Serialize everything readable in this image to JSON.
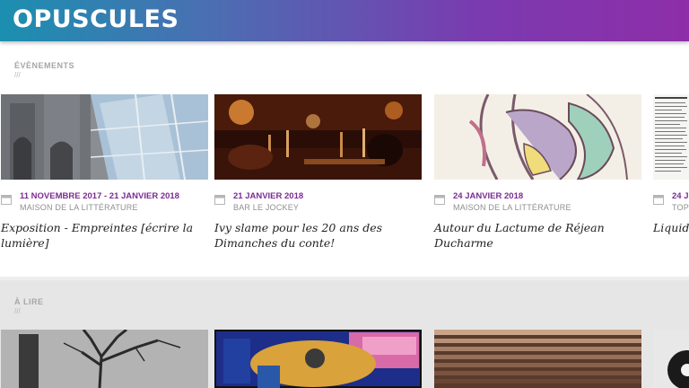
{
  "header": {
    "logo_text": "OPUSCULES",
    "logo_icon": "wifi-wave-icon"
  },
  "events": {
    "title": "ÉVÈNEMENTS",
    "slashes": "///",
    "cards": [
      {
        "date": "11 NOVEMBRE 2017 - 21 JANVIER 2018",
        "venue": "MAISON DE LA LITTÉRATURE",
        "title": "Exposition - Empreintes [écrire la lumière]",
        "image_icon": "church-facade-photo"
      },
      {
        "date": "21 JANVIER 2018",
        "venue": "BAR LE JOCKEY",
        "title": "Ivy slame pour les 20 ans des Dimanches du conte!",
        "image_icon": "bar-photo"
      },
      {
        "date": "24 JANVIER 2018",
        "venue": "MAISON DE LA LITTÉRATURE",
        "title": "Autour du Lactume de Réjean Ducharme",
        "image_icon": "stained-drawing-image"
      },
      {
        "date": "24 J",
        "venue": "TOPO",
        "title": "Liquida",
        "image_icon": "newspaper-clipping-image"
      }
    ]
  },
  "read": {
    "title": "À LIRE",
    "slashes": "///"
  },
  "colors": {
    "accent": "#7b2c93",
    "header_start": "#1b8fb0",
    "header_end": "#8e2ea8"
  }
}
